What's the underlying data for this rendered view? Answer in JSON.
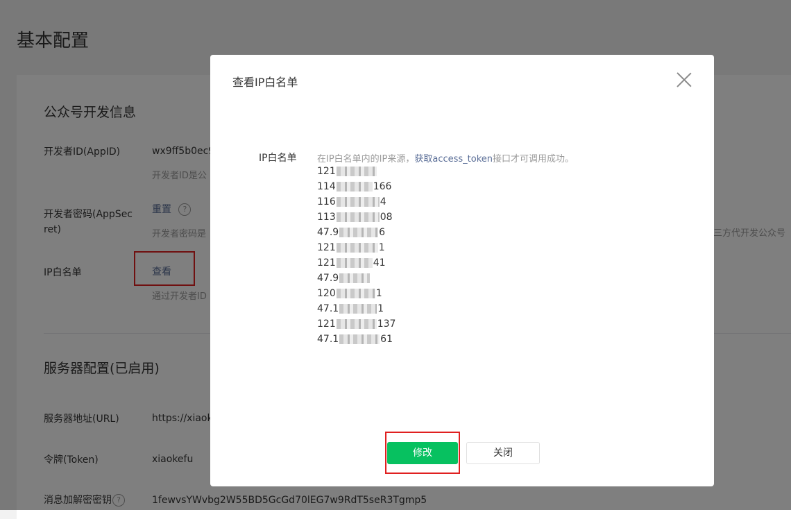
{
  "page": {
    "title": "基本配置"
  },
  "dev_info": {
    "section_title": "公众号开发信息",
    "appid_label": "开发者ID(AppID)",
    "appid_value": "wx9ff5b0ec9",
    "appid_desc": "开发者ID是公",
    "secret_label": "开发者密码(AppSecret)",
    "secret_action": "重置",
    "secret_desc": "开发者密码是",
    "secret_desc_right": "三方代开发公众号",
    "ip_label": "IP白名单",
    "ip_action": "查看",
    "ip_desc": "通过开发者ID"
  },
  "server_config": {
    "section_title": "服务器配置(已启用)",
    "url_label": "服务器地址(URL)",
    "url_value": "https://xiaok",
    "token_label": "令牌(Token)",
    "token_value": "xiaokefu",
    "aes_label": "消息加解密密钥",
    "aes_value": "1fewvsYWvbg2W55BD5GcGd70lEG7w9RdT5seR3Tgmp5"
  },
  "dialog": {
    "title": "查看IP白名单",
    "ip_label": "IP白名单",
    "hint_prefix": "在IP白名单内的IP来源，",
    "hint_link": "获取access_token",
    "hint_suffix": "接口才可调用成功。",
    "ips": [
      {
        "pre": "121",
        "suf": ""
      },
      {
        "pre": "114",
        "suf": "166"
      },
      {
        "pre": "116",
        "suf": "4"
      },
      {
        "pre": "113",
        "suf": "08"
      },
      {
        "pre": "47.9",
        "suf": "6"
      },
      {
        "pre": "121",
        "suf": "1"
      },
      {
        "pre": "121",
        "suf": "41"
      },
      {
        "pre": "47.9",
        "suf": ""
      },
      {
        "pre": "120",
        "suf": "1"
      },
      {
        "pre": "47.1",
        "suf": "1"
      },
      {
        "pre": "121",
        "suf": "137"
      },
      {
        "pre": "47.1",
        "suf": "61"
      }
    ],
    "modify_label": "修改",
    "close_label": "关闭"
  },
  "colors": {
    "primary": "#07c160",
    "link": "#576b95",
    "highlight": "#e02020"
  }
}
